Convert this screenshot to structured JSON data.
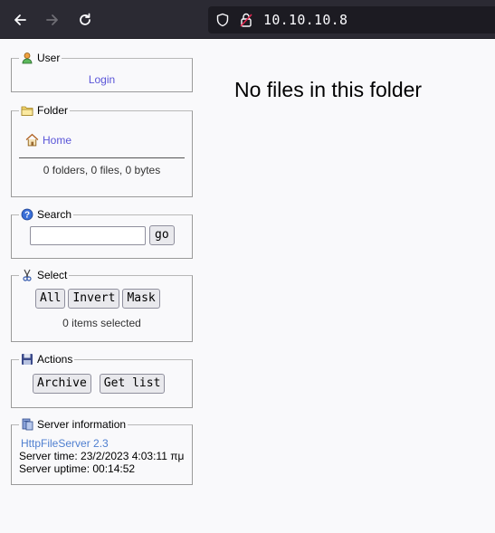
{
  "browser": {
    "url": "10.10.10.8"
  },
  "user_panel": {
    "legend": "User",
    "login_label": "Login"
  },
  "folder_panel": {
    "legend": "Folder",
    "home_label": "Home",
    "summary": "0 folders, 0 files, 0 bytes"
  },
  "search_panel": {
    "legend": "Search",
    "query": "",
    "go_label": "go"
  },
  "select_panel": {
    "legend": "Select",
    "all_label": "All",
    "invert_label": "Invert",
    "mask_label": "Mask",
    "selected_text": "0 items selected"
  },
  "actions_panel": {
    "legend": "Actions",
    "archive_label": "Archive",
    "get_list_label": "Get list"
  },
  "server_panel": {
    "legend": "Server information",
    "server_link": "HttpFileServer 2.3",
    "server_time": "Server time: 23/2/2023 4:03:11 πμ",
    "server_uptime": "Server uptime: 00:14:52"
  },
  "main": {
    "message": "No files in this folder"
  },
  "icons": {
    "back": "arrow-left-icon",
    "forward": "arrow-right-icon",
    "reload": "reload-icon",
    "shield": "shield-icon",
    "lock": "insecure-lock-icon",
    "user": "user-icon",
    "folder": "folder-icon",
    "home": "home-icon",
    "search": "help-icon",
    "select": "scissors-icon",
    "actions": "floppy-disk-icon",
    "server": "server-icon"
  },
  "colors": {
    "toolbar_bg": "#2b2a33",
    "urlbar_bg": "#1c1b22",
    "link": "#5a55d8",
    "page_bg": "#f9f9fb"
  }
}
